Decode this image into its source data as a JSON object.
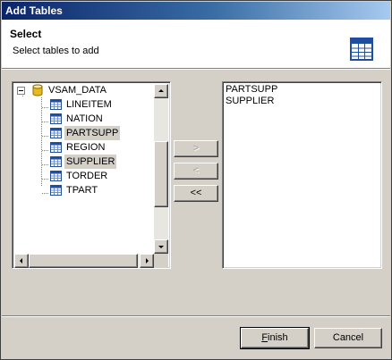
{
  "window": {
    "title": "Add Tables"
  },
  "header": {
    "title": "Select",
    "subtitle": "Select tables to add",
    "icon": "table-grid-icon"
  },
  "source_tree": {
    "root": {
      "label": "VSAM_DATA",
      "expanded": true,
      "icon": "database-icon"
    },
    "items": [
      {
        "label": "LINEITEM",
        "highlighted": false,
        "icon": "table-icon"
      },
      {
        "label": "NATION",
        "highlighted": false,
        "icon": "table-icon"
      },
      {
        "label": "PARTSUPP",
        "highlighted": true,
        "icon": "table-icon"
      },
      {
        "label": "REGION",
        "highlighted": false,
        "icon": "table-icon"
      },
      {
        "label": "SUPPLIER",
        "highlighted": true,
        "icon": "table-icon"
      },
      {
        "label": "TORDER",
        "highlighted": false,
        "icon": "table-icon"
      },
      {
        "label": "TPART",
        "highlighted": false,
        "icon": "table-icon"
      }
    ]
  },
  "move_buttons": {
    "add": ">",
    "remove": "<",
    "remove_all": "<<"
  },
  "selected_tables": [
    "PARTSUPP",
    "SUPPLIER"
  ],
  "footer": {
    "finish_label": "Finish",
    "cancel_label": "Cancel"
  },
  "colors": {
    "title_bar_start": "#0a246a",
    "title_bar_end": "#a6caf0",
    "dialog_bg": "#d4d0c8",
    "table_icon_blue": "#1f4e9e"
  }
}
